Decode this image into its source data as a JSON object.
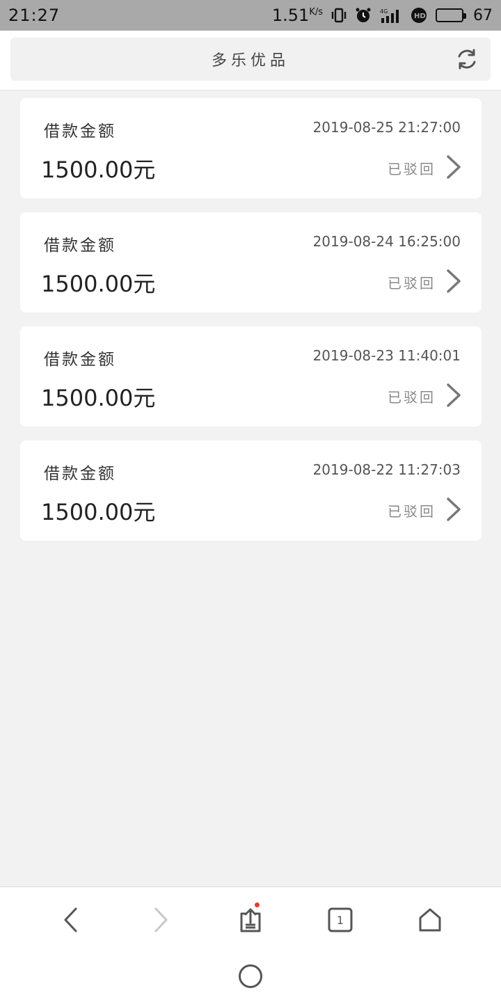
{
  "status_bar": {
    "time": "21:27",
    "speed": "1.51",
    "speed_unit": "K/s",
    "battery": "67",
    "icons": [
      "vibrate-icon",
      "alarm-icon",
      "signal-4g-icon",
      "hd-icon",
      "battery-icon"
    ]
  },
  "header": {
    "title": "多乐优品",
    "refresh_icon": "refresh-icon"
  },
  "records": [
    {
      "label": "借款金额",
      "time": "2019-08-25 21:27:00",
      "amount": "1500.00元",
      "status": "已驳回"
    },
    {
      "label": "借款金额",
      "time": "2019-08-24 16:25:00",
      "amount": "1500.00元",
      "status": "已驳回"
    },
    {
      "label": "借款金额",
      "time": "2019-08-23 11:40:01",
      "amount": "1500.00元",
      "status": "已驳回"
    },
    {
      "label": "借款金额",
      "time": "2019-08-22 11:27:03",
      "amount": "1500.00元",
      "status": "已驳回"
    }
  ],
  "bottom_nav": {
    "tab_count": "1",
    "icons": [
      "back-icon",
      "forward-icon",
      "share-icon",
      "tabs-icon",
      "home-icon"
    ]
  },
  "colors": {
    "status_bar_bg": "#a9a9a9",
    "page_bg": "#f2f2f2",
    "notification_dot": "#e53935"
  }
}
